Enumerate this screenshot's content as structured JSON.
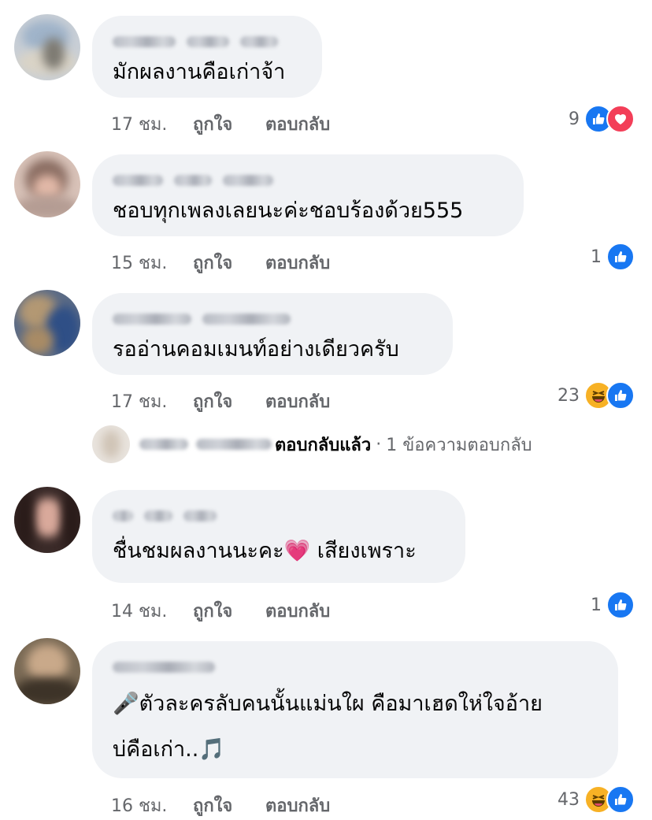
{
  "comments": [
    {
      "text": "มักผลงานคือเก่าจ้า",
      "time": "17 ชม.",
      "like_label": "ถูกใจ",
      "reply_label": "ตอบกลับ",
      "reaction_count": "9",
      "reactions": [
        "like",
        "love"
      ]
    },
    {
      "text": "ชอบทุกเพลงเลยนะค่ะชอบร้องด้วย555",
      "time": "15 ชม.",
      "like_label": "ถูกใจ",
      "reply_label": "ตอบกลับ",
      "reaction_count": "1",
      "reactions": [
        "like"
      ]
    },
    {
      "text": "รออ่านคอมเมนท์อย่างเดียวครับ",
      "time": "17 ชม.",
      "like_label": "ถูกใจ",
      "reply_label": "ตอบกลับ",
      "reaction_count": "23",
      "reactions": [
        "haha",
        "like"
      ],
      "replies_summary": {
        "replied_label": "ตอบกลับแล้ว",
        "separator": "·",
        "count_label": "1 ข้อความตอบกลับ"
      }
    },
    {
      "text": "ชื่นชมผลงานนะคะ💗 เสียงเพราะ",
      "time": "14 ชม.",
      "like_label": "ถูกใจ",
      "reply_label": "ตอบกลับ",
      "reaction_count": "1",
      "reactions": [
        "like"
      ]
    },
    {
      "text_line1": "🎤ตัวละครลับคนนั้นแม่นใผ คือมาเฮดให่ใจอ้าย",
      "text_line2": "บ่คือเก่า..🎵",
      "time": "16 ชม.",
      "like_label": "ถูกใจ",
      "reply_label": "ตอบกลับ",
      "reaction_count": "43",
      "reactions": [
        "haha",
        "like"
      ]
    }
  ],
  "colors": {
    "bubble": "#f0f2f5",
    "meta_text": "#65676b",
    "like_blue": "#1877f2",
    "love_red": "#f33e58",
    "haha_yellow": "#f7b125"
  }
}
